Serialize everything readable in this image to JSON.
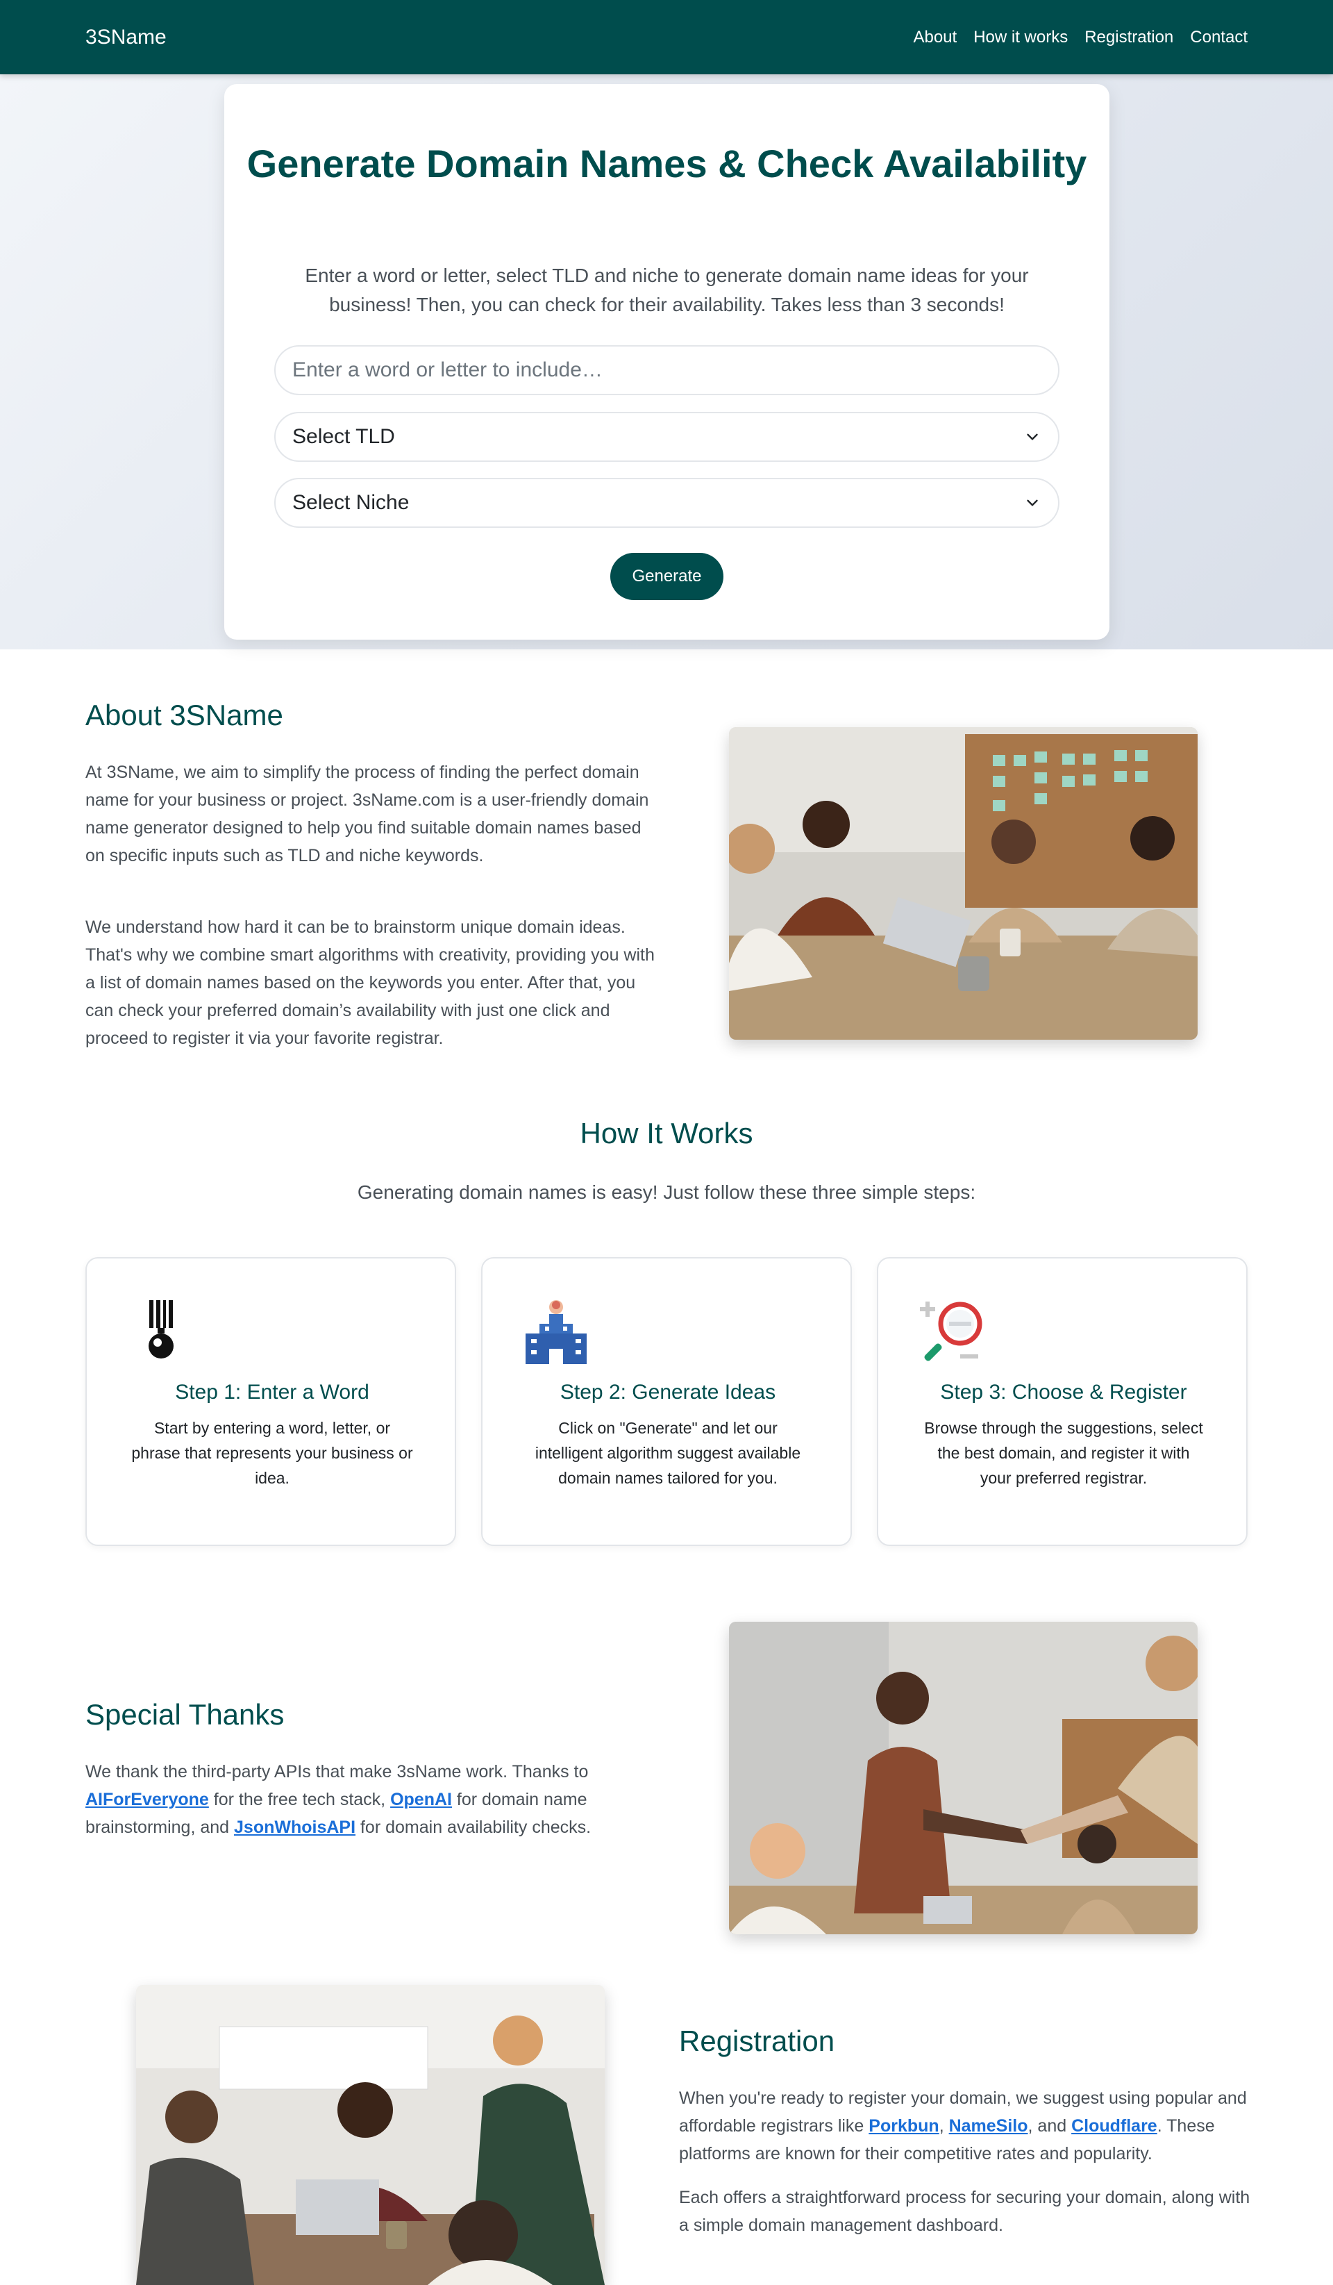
{
  "nav": {
    "brand": "3SName",
    "links": [
      "About",
      "How it works",
      "Registration",
      "Contact"
    ]
  },
  "hero": {
    "title": "Generate Domain Names & Check Availability",
    "description": "Enter a word or letter, select TLD and niche to generate domain name ideas for your business! Then, you can check for their availability. Takes less than 3 seconds!",
    "input_placeholder": "Enter a word or letter to include…",
    "tld_select": "Select TLD",
    "niche_select": "Select Niche",
    "generate_label": "Generate"
  },
  "about": {
    "title": "About 3SName",
    "p1": "At 3SName, we aim to simplify the process of finding the perfect domain name for your business or project. 3sName.com is a user-friendly domain name generator designed to help you find suitable domain names based on specific inputs such as TLD and niche keywords.",
    "p2": "We understand how hard it can be to brainstorm unique domain ideas. That's why we combine smart algorithms with creativity, providing you with a list of domain names based on the keywords you enter. After that, you can check your preferred domain’s availability with just one click and proceed to register it via your favorite registrar."
  },
  "how": {
    "title": "How It Works",
    "subtitle": "Generating domain names is easy! Just follow these three simple steps:",
    "steps": [
      {
        "icon": "medal-icon",
        "title": "Step 1: Enter a Word",
        "text": "Start by entering a word, letter, or phrase that represents your business or idea."
      },
      {
        "icon": "office-building-icon",
        "title": "Step 2: Generate Ideas",
        "text": "Click on \"Generate\" and let our intelligent algorithm suggest available domain names tailored for you."
      },
      {
        "icon": "magnifying-glass-icon",
        "title": "Step 3: Choose & Register",
        "text": "Browse through the suggestions, select the best domain, and register it with your preferred registrar."
      }
    ]
  },
  "thanks": {
    "title": "Special Thanks",
    "t1": "We thank the third-party APIs that make 3sName work. Thanks to ",
    "link1": "AIForEveryone",
    "t2": " for the free tech stack, ",
    "link2": "OpenAI",
    "t3": " for domain name brainstorming, and ",
    "link3": "JsonWhoisAPI",
    "t4": " for domain availability checks."
  },
  "registration": {
    "title": "Registration",
    "t1": "When you're ready to register your domain, we suggest using popular and affordable registrars like ",
    "link1": "Porkbun",
    "t2": ", ",
    "link2": "NameSilo",
    "t3": ", and ",
    "link3": "Cloudflare",
    "t4": ". These platforms are known for their competitive rates and popularity.",
    "p2": "Each offers a straightforward process for securing your domain, along with a simple domain management dashboard."
  },
  "colors": {
    "brand": "#004d4d",
    "link": "#1a6ed8",
    "text": "#495057"
  }
}
